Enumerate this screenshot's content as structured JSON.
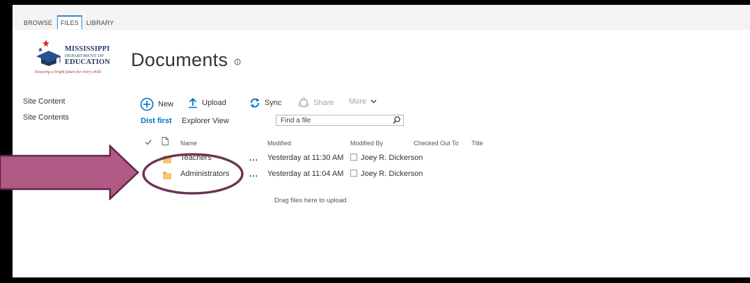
{
  "ribbon": {
    "tabs": [
      {
        "label": "BROWSE"
      },
      {
        "label": "FILES"
      },
      {
        "label": "LIBRARY"
      }
    ],
    "active": "FILES"
  },
  "logo": {
    "line1": "MISSISSIPPI",
    "line2": "DEPARTMENT OF",
    "line3": "EDUCATION",
    "tagline": "Ensuring a bright future for every child"
  },
  "page": {
    "title": "Documents"
  },
  "nav": {
    "items": [
      {
        "label": "Site Content"
      },
      {
        "label": "Site Contents"
      }
    ]
  },
  "toolbar": {
    "new_label": "New",
    "upload_label": "Upload",
    "sync_label": "Sync",
    "share_label": "Share",
    "more_label": "More"
  },
  "views": {
    "current": "Dist first",
    "other": "Explorer View"
  },
  "search": {
    "placeholder": "Find a file"
  },
  "columns": {
    "name": "Name",
    "modified": "Modified",
    "modified_by": "Modified By",
    "checked_out_to": "Checked Out To",
    "title": "Title"
  },
  "rows": [
    {
      "name": "Teachers",
      "ellipsis": "...",
      "modified": "Yesterday at 11:30 AM",
      "modified_by": "Joey R. Dickerson"
    },
    {
      "name": "Administrators",
      "ellipsis": "...",
      "modified": "Yesterday at 11:04 AM",
      "modified_by": "Joey R. Dickerson"
    }
  ],
  "drop_hint": "Drag files here to upload",
  "colors": {
    "accent": "#0072c6",
    "arrow_fill": "#b05a85",
    "arrow_stroke": "#5e2748",
    "ellipse_stroke": "#6d3556"
  },
  "icons": {
    "new": "plus-circle-icon",
    "upload": "up-arrow-icon",
    "sync": "sync-icon",
    "share": "share-icon",
    "more": "chevron-down-icon"
  }
}
